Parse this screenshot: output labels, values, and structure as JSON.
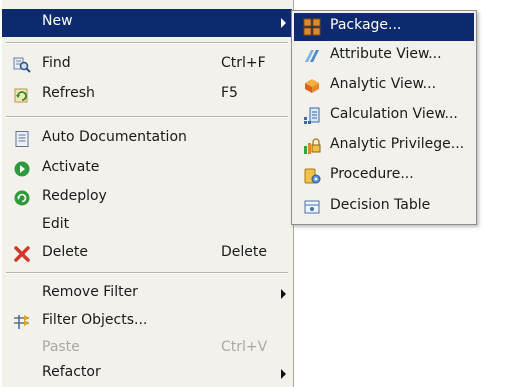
{
  "context_menu": {
    "new": {
      "label": "New"
    },
    "find": {
      "label": "Find",
      "shortcut": "Ctrl+F",
      "icon": "find-icon"
    },
    "refresh": {
      "label": "Refresh",
      "shortcut": "F5",
      "icon": "refresh-icon"
    },
    "auto_documentation": {
      "label": "Auto Documentation",
      "icon": "document-icon"
    },
    "activate": {
      "label": "Activate",
      "icon": "activate-icon"
    },
    "redeploy": {
      "label": "Redeploy",
      "icon": "redeploy-icon"
    },
    "edit": {
      "label": "Edit"
    },
    "delete": {
      "label": "Delete",
      "shortcut": "Delete",
      "icon": "delete-icon"
    },
    "remove_filter": {
      "label": "Remove Filter"
    },
    "filter_objects": {
      "label": "Filter Objects...",
      "icon": "filter-icon"
    },
    "paste": {
      "label": "Paste",
      "shortcut": "Ctrl+V",
      "disabled": true
    },
    "refactor": {
      "label": "Refactor"
    }
  },
  "submenu": {
    "package": {
      "label": "Package...",
      "icon": "package-icon"
    },
    "attribute_view": {
      "label": "Attribute View...",
      "icon": "attribute-view-icon"
    },
    "analytic_view": {
      "label": "Analytic View...",
      "icon": "analytic-view-icon"
    },
    "calculation_view": {
      "label": "Calculation View...",
      "icon": "calculation-view-icon"
    },
    "analytic_privilege": {
      "label": "Analytic Privilege...",
      "icon": "analytic-privilege-icon"
    },
    "procedure": {
      "label": "Procedure...",
      "icon": "procedure-icon"
    },
    "decision_table": {
      "label": "Decision Table",
      "icon": "decision-table-icon"
    }
  },
  "colors": {
    "menu_background": "#f2f1ec",
    "highlight": "#0e2a6e",
    "disabled_text": "#a9a8a4"
  }
}
